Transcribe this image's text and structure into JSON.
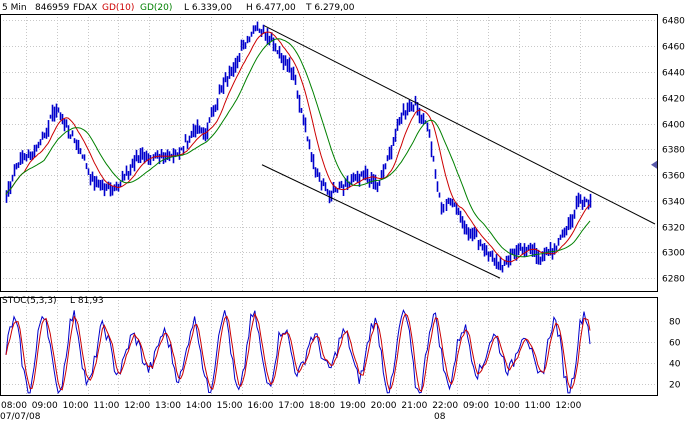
{
  "header": {
    "interval": "5 Min",
    "code": "846959",
    "symbol": "FDAX",
    "gd10_label": "GD(10)",
    "gd20_label": "GD(20)",
    "low_label": "L 6.339,00",
    "high_label": "H 6.477,00",
    "t_label": "T 6.279,00"
  },
  "stoch_header": {
    "label": "STOC(5,3,3)",
    "value_label": "L 81,93"
  },
  "colors": {
    "price": "#0000cc",
    "gd10": "#cc0000",
    "gd20": "#008000",
    "grid": "#c8c8c8",
    "stoch_k": "#0000cc",
    "stoch_d": "#cc0000",
    "marker": "#5a5aaa"
  },
  "chart_data": [
    {
      "type": "bar",
      "name": "price",
      "x_labels": [
        "08:00",
        "09:00",
        "10:00",
        "11:00",
        "12:00",
        "13:00",
        "14:00",
        "15:00",
        "16:00",
        "17:00",
        "18:00",
        "19:00",
        "20:00",
        "21:00",
        "22:00",
        "09:00",
        "10:00",
        "11:00",
        "12:00"
      ],
      "date_labels": [
        "07/07/08",
        "08"
      ],
      "ylim": [
        6270,
        6485
      ],
      "yticks": [
        6280,
        6300,
        6320,
        6340,
        6360,
        6380,
        6400,
        6420,
        6440,
        6460,
        6480
      ],
      "grid": true,
      "series": [
        {
          "name": "GD(10)",
          "kind": "moving-average"
        },
        {
          "name": "GD(20)",
          "kind": "moving-average"
        }
      ],
      "anchors_y": [
        6345,
        6372,
        6375,
        6390,
        6412,
        6395,
        6380,
        6355,
        6350,
        6352,
        6365,
        6377,
        6372,
        6375,
        6378,
        6395,
        6392,
        6420,
        6440,
        6458,
        6476,
        6470,
        6455,
        6440,
        6400,
        6360,
        6345,
        6350,
        6355,
        6360,
        6352,
        6380,
        6410,
        6415,
        6395,
        6335,
        6340,
        6318,
        6310,
        6296,
        6290,
        6300,
        6305,
        6295,
        6303,
        6315,
        6338,
        6342
      ],
      "trendlines": [
        {
          "from": [
            "16:00",
            6476
          ],
          "to": [
            "12:40",
            6322
          ]
        },
        {
          "from": [
            "16:00",
            6368
          ],
          "to": [
            "10:00",
            6280
          ]
        }
      ],
      "marker_value": 6368
    },
    {
      "type": "line",
      "name": "STOC(5,3,3)",
      "ylim": [
        10,
        95
      ],
      "yticks": [
        20,
        40,
        60,
        80
      ],
      "grid": true,
      "last_value": 81.93
    }
  ]
}
